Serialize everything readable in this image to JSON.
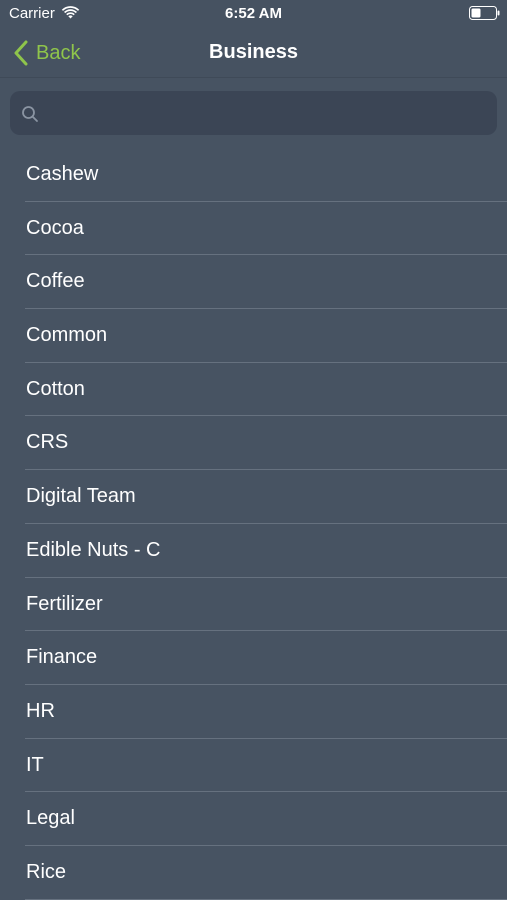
{
  "status_bar": {
    "carrier": "Carrier",
    "time": "6:52 AM"
  },
  "nav": {
    "back_label": "Back",
    "title": "Business",
    "accent_color": "#8fc54b"
  },
  "search": {
    "value": "",
    "placeholder": ""
  },
  "items": [
    {
      "label": "Cashew"
    },
    {
      "label": "Cocoa"
    },
    {
      "label": "Coffee"
    },
    {
      "label": "Common"
    },
    {
      "label": "Cotton"
    },
    {
      "label": "CRS"
    },
    {
      "label": "Digital Team"
    },
    {
      "label": "Edible Nuts - C"
    },
    {
      "label": "Fertilizer"
    },
    {
      "label": "Finance"
    },
    {
      "label": "HR"
    },
    {
      "label": "IT"
    },
    {
      "label": "Legal"
    },
    {
      "label": "Rice"
    }
  ],
  "icons": {
    "wifi": "wifi-icon",
    "battery": "battery-icon",
    "back": "chevron-left-icon",
    "search": "search-icon"
  }
}
